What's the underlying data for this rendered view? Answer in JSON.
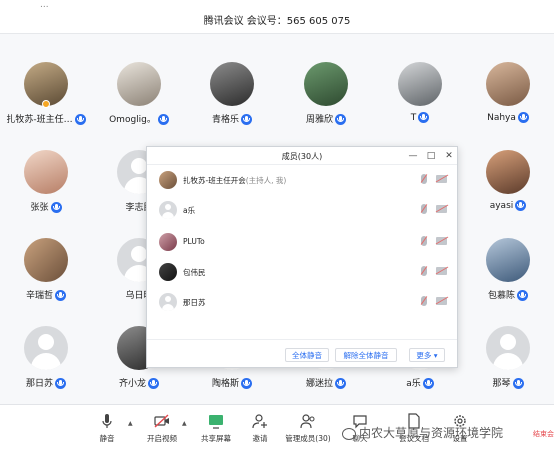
{
  "window": {
    "app_fragment": "...",
    "meeting_title": "腾讯会议 会议号：565 605 075"
  },
  "gallery": {
    "participants": [
      {
        "name": "扎牧苏-班主任…"
      },
      {
        "name": "Omoglig。"
      },
      {
        "name": "青格乐"
      },
      {
        "name": "周雅欣"
      },
      {
        "name": "T"
      },
      {
        "name": "Nahya"
      },
      {
        "name": "张张"
      },
      {
        "name": "李志民"
      },
      {
        "name": "ayasi"
      },
      {
        "name": "辛瑞哲"
      },
      {
        "name": "乌日暖"
      },
      {
        "name": "包慕陈"
      },
      {
        "name": "那日苏"
      },
      {
        "name": "齐小龙"
      },
      {
        "name": "陶格斯"
      },
      {
        "name": "娜迷拉"
      },
      {
        "name": "a乐"
      },
      {
        "name": "那琴"
      }
    ]
  },
  "members_panel": {
    "title": "成员(30人)",
    "window_buttons": {
      "minimize": "—",
      "maximize": "□",
      "close": "✕"
    },
    "members": [
      {
        "name": "扎牧苏-班主任开会",
        "role": "(主持人, 我)"
      },
      {
        "name": "a乐",
        "role": ""
      },
      {
        "name": "PLUTo",
        "role": ""
      },
      {
        "name": "包伟民",
        "role": ""
      },
      {
        "name": "那日苏",
        "role": ""
      }
    ],
    "footer": {
      "mute_all": "全体静音",
      "unmute_all": "解除全体静音",
      "more": "更多 ▾"
    }
  },
  "toolbar": {
    "mute": "静音",
    "start_video": "开启视频",
    "share_screen": "共享屏幕",
    "invite": "邀请",
    "manage_members": "管理成员(30)",
    "chat": "聊天",
    "meeting_docs": "会议文档",
    "settings": "设置",
    "end_meeting": "结束会"
  },
  "watermark": {
    "text": "内农大草原与资源环境学院"
  },
  "colors": {
    "accent": "#2a6ef0",
    "end": "#e5484d",
    "muted_red": "#e36d6d"
  },
  "icons": {
    "mic": "microphone-icon",
    "camera_off": "camera-off-icon",
    "share": "screen-share-icon",
    "invite": "invite-icon",
    "members": "members-icon",
    "chat": "chat-icon",
    "docs": "document-icon",
    "settings": "gear-icon"
  }
}
